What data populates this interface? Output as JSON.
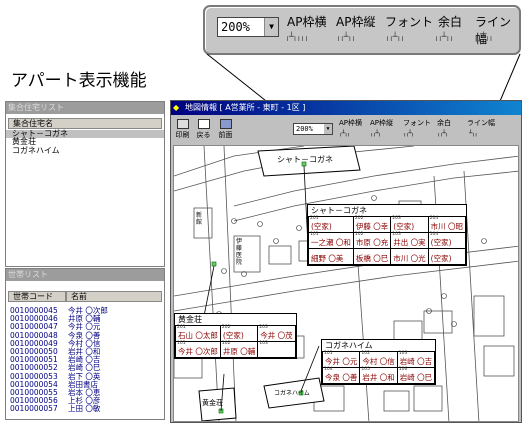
{
  "zoom_callout": {
    "zoom_value": "200%",
    "labels": [
      "AP枠横",
      "AP枠縦",
      "フォント",
      "余白",
      "ライン幅"
    ]
  },
  "heading": "アパート表示機能",
  "apartment_list": {
    "pane_title": "集合住宅リスト",
    "column": "集合住宅名",
    "items": [
      "シャト－コガネ",
      "黄金荘",
      "コガネハイム"
    ]
  },
  "household_list": {
    "pane_title": "世帯リスト",
    "columns": [
      "世帯コード",
      "名前"
    ],
    "rows": [
      [
        "0010000045",
        "今井 〇次郎"
      ],
      [
        "0010000046",
        "井原 〇輔"
      ],
      [
        "0010000047",
        "今井 〇元"
      ],
      [
        "0010000048",
        "今泉 〇善"
      ],
      [
        "0010000049",
        "今村 〇信"
      ],
      [
        "0010000050",
        "岩井 〇和"
      ],
      [
        "0010000051",
        "岩崎 〇吉"
      ],
      [
        "0010000052",
        "岩崎 〇巳"
      ],
      [
        "0010000053",
        "岩下 〇英"
      ],
      [
        "0010000054",
        "岩田書店"
      ],
      [
        "0010000055",
        "岩本 〇恵"
      ],
      [
        "0010000056",
        "上杉 〇彦"
      ],
      [
        "0010000057",
        "上田 〇敏"
      ]
    ]
  },
  "map_window": {
    "title": "地図情報 [ A営業所 - 東町 - 1区 ]",
    "buttons": [
      "印刷",
      "戻る",
      "前面"
    ],
    "zoom_value": "200%",
    "toolbar_labels": [
      "AP枠横",
      "AP枠縦",
      "フォント",
      "余白",
      "ライン幅"
    ]
  },
  "map": {
    "building_labels": {
      "chateau": "シャト－コガネ",
      "kogane_so": "黄金荘",
      "kogane_heim": "コガネハイム",
      "ito": "伊藤医院",
      "shinkan": "新館"
    },
    "chateau_popup": {
      "title": "シャト－コガネ",
      "rows": [
        [
          {
            "no": "201",
            "name": "(空家)"
          },
          {
            "no": "202",
            "name": "伊藤 〇幸"
          },
          {
            "no": "203",
            "name": "(空家)"
          },
          {
            "no": "204",
            "name": "市川 〇昭"
          }
        ],
        [
          {
            "no": "101",
            "name": "一之瀬 〇和"
          },
          {
            "no": "102",
            "name": "市原 〇充"
          },
          {
            "no": "103",
            "name": "井出 〇実"
          },
          {
            "no": "104",
            "name": "(空家)"
          }
        ],
        [
          {
            "no": "",
            "name": "細野 〇美"
          },
          {
            "no": "",
            "name": "板橋 〇巳"
          },
          {
            "no": "",
            "name": "市川 〇光"
          },
          {
            "no": "",
            "name": "(空家)"
          }
        ]
      ]
    },
    "kogane_so_popup": {
      "title": "黄金荘",
      "rows": [
        [
          {
            "no": "201",
            "name": "石山 〇太郎"
          },
          {
            "no": "202",
            "name": "(空家)"
          },
          {
            "no": "203",
            "name": "今井 〇茂"
          }
        ],
        [
          {
            "no": "101",
            "name": "今井 〇次郎"
          },
          {
            "no": "102",
            "name": "井原 〇輔"
          },
          {
            "no": "103",
            "name": ""
          }
        ]
      ]
    },
    "kogane_heim_popup": {
      "title": "コガネハイム",
      "rows": [
        [
          {
            "no": "101",
            "name": "今井 〇元"
          },
          {
            "no": "102",
            "name": "今村 〇信"
          },
          {
            "no": "103",
            "name": "岩崎 〇吉"
          }
        ],
        [
          {
            "no": "104",
            "name": "今泉 〇善"
          },
          {
            "no": "105",
            "name": "岩井 〇和"
          },
          {
            "no": "106",
            "name": "岩崎 〇巳"
          }
        ]
      ]
    }
  }
}
